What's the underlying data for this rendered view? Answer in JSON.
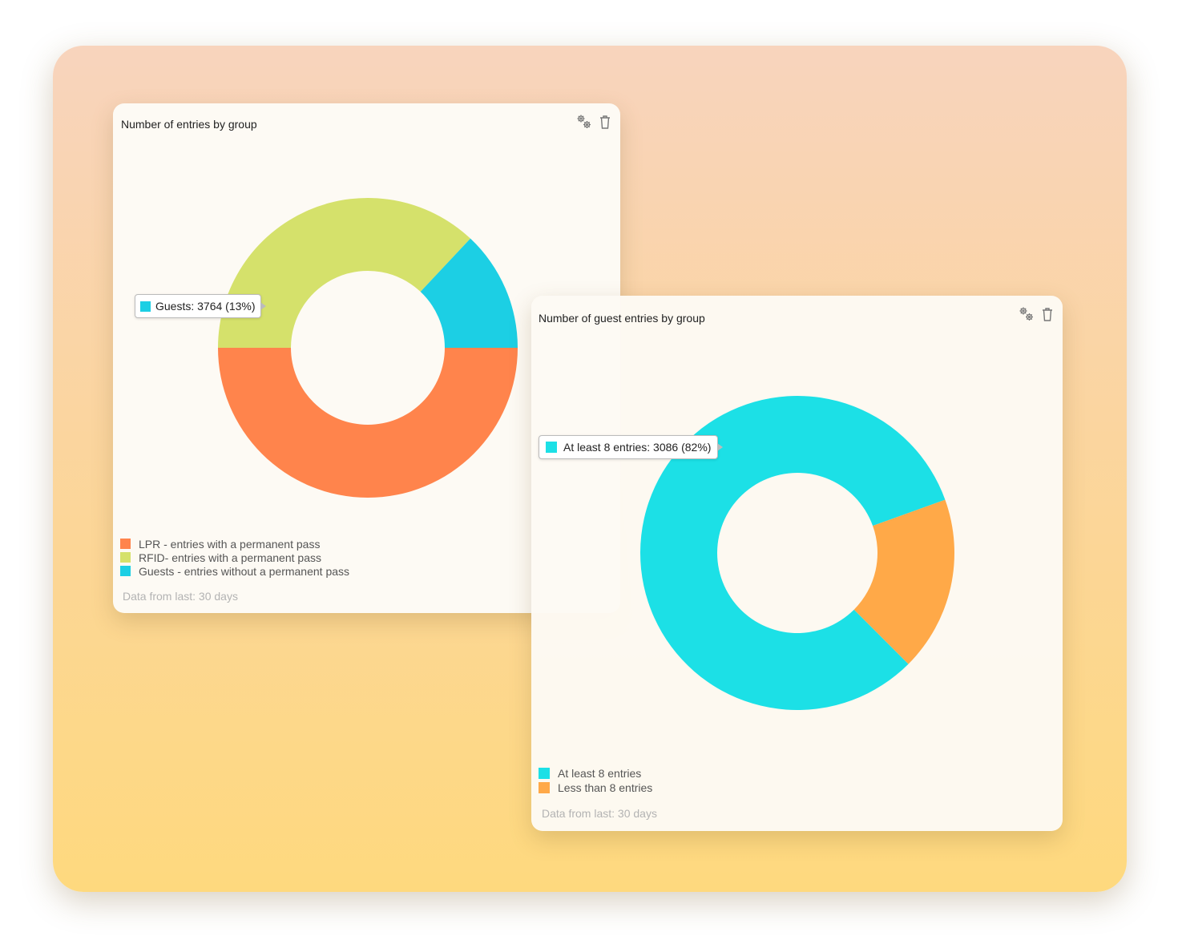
{
  "colors": {
    "lpr": "#ff844c",
    "rfid": "#d5e16b",
    "guests": "#1ccfe4",
    "at_least_8": "#1ce0e6",
    "less_than_8": "#ffa948"
  },
  "icons": [
    "settings-gears-icon",
    "trash-icon"
  ],
  "card1": {
    "title": "Number of entries by group",
    "footnote": "Data from last: 30 days",
    "tooltip": "Guests: 3764 (13%)",
    "legend": [
      {
        "label": "LPR - entries with a permanent pass"
      },
      {
        "label": "RFID- entries with a permanent pass"
      },
      {
        "label": "Guests - entries without a permanent pass"
      }
    ]
  },
  "card2": {
    "title": "Number of guest entries by group",
    "footnote": "Data from last: 30 days",
    "tooltip": "At least 8 entries: 3086 (82%)",
    "legend": [
      {
        "label": "At least 8 entries"
      },
      {
        "label": "Less than 8 entries"
      }
    ]
  },
  "chart_data": [
    {
      "type": "pie",
      "title": "Number of entries by group",
      "categories": [
        "LPR - entries with a permanent pass",
        "RFID- entries with a permanent pass",
        "Guests - entries without a permanent pass"
      ],
      "values": [
        50,
        37,
        13
      ],
      "legend_position": "bottom-left"
    },
    {
      "type": "pie",
      "title": "Number of guest entries by group",
      "categories": [
        "At least 8 entries",
        "Less than 8 entries"
      ],
      "values": [
        82,
        18
      ],
      "legend_position": "bottom-left"
    }
  ]
}
